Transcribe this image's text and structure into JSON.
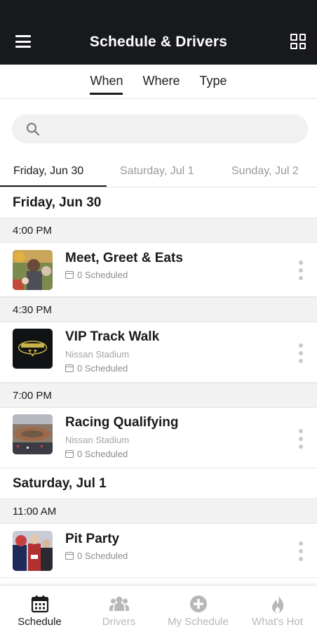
{
  "colors": {
    "appbar": "#17191d",
    "active": "#1a1a1a",
    "inactive": "#b8b8b8",
    "section_bg": "#f2f2f2"
  },
  "header": {
    "title": "Schedule & Drivers",
    "menu_icon": "hamburger-menu-icon",
    "grid_icon": "grid-view-icon"
  },
  "filter_tabs": [
    {
      "label": "When",
      "active": true
    },
    {
      "label": "Where",
      "active": false
    },
    {
      "label": "Type",
      "active": false
    }
  ],
  "search": {
    "placeholder": "",
    "icon": "search-icon"
  },
  "day_tabs": [
    {
      "label": "Friday, Jun 30",
      "active": true
    },
    {
      "label": "Saturday, Jul 1",
      "active": false
    },
    {
      "label": "Sunday, Jul 2",
      "active": false
    }
  ],
  "days": [
    {
      "label": "Friday, Jun 30",
      "slots": [
        {
          "time": "4:00 PM",
          "event": {
            "title": "Meet, Greet & Eats",
            "location": "",
            "scheduled": "0 Scheduled"
          }
        },
        {
          "time": "4:30 PM",
          "event": {
            "title": "VIP Track Walk",
            "location": "Nissan Stadium",
            "scheduled": "0 Scheduled"
          }
        },
        {
          "time": "7:00 PM",
          "event": {
            "title": "Racing Qualifying",
            "location": "Nissan Stadium",
            "scheduled": "0 Scheduled"
          }
        }
      ]
    },
    {
      "label": "Saturday, Jul 1",
      "slots": [
        {
          "time": "11:00 AM",
          "event": {
            "title": "Pit Party",
            "location": "",
            "scheduled": "0 Scheduled"
          }
        }
      ]
    }
  ],
  "bottom_nav": [
    {
      "label": "Schedule",
      "icon": "calendar-icon",
      "active": true
    },
    {
      "label": "Drivers",
      "icon": "people-icon",
      "active": false
    },
    {
      "label": "My Schedule",
      "icon": "plus-circle-icon",
      "active": false
    },
    {
      "label": "What's Hot",
      "icon": "flame-icon",
      "active": false
    }
  ]
}
